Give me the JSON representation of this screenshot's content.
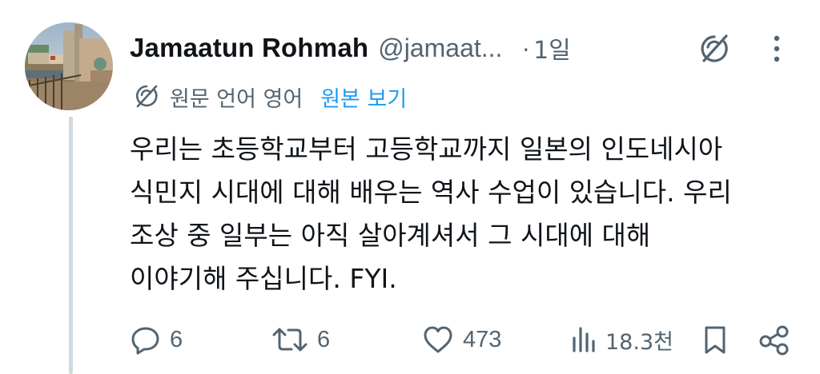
{
  "tweet": {
    "author": {
      "display_name": "Jamaatun Rohmah",
      "handle": "@jamaat...",
      "avatar_icon": "avatar-photo"
    },
    "dot": "·",
    "time": "1일",
    "translation": {
      "label": "원문 언어 영어",
      "show_original": "원본 보기",
      "icon": "translate-icon"
    },
    "text_lines": [
      "우리는 초등학교부터 고등학교까지 일본의 인도네시아",
      "식민지 시대에 대해 배우는 역사 수업이 있습니다. 우리",
      "조상 중 일부는 아직 살아계셔서 그 시대에 대해",
      "이야기해 주십니다. FYI."
    ],
    "actions": {
      "replies": "6",
      "reposts": "6",
      "likes": "473",
      "views": "18.3천"
    },
    "header_icons": [
      "grok-icon",
      "more-icon"
    ],
    "action_icons": [
      "reply-icon",
      "repost-icon",
      "like-icon",
      "views-icon",
      "bookmark-icon",
      "share-icon"
    ]
  },
  "colors": {
    "text": "#0f1419",
    "secondary": "#536471",
    "accent": "#1d9bf0",
    "thread_line": "#cfd9de"
  }
}
